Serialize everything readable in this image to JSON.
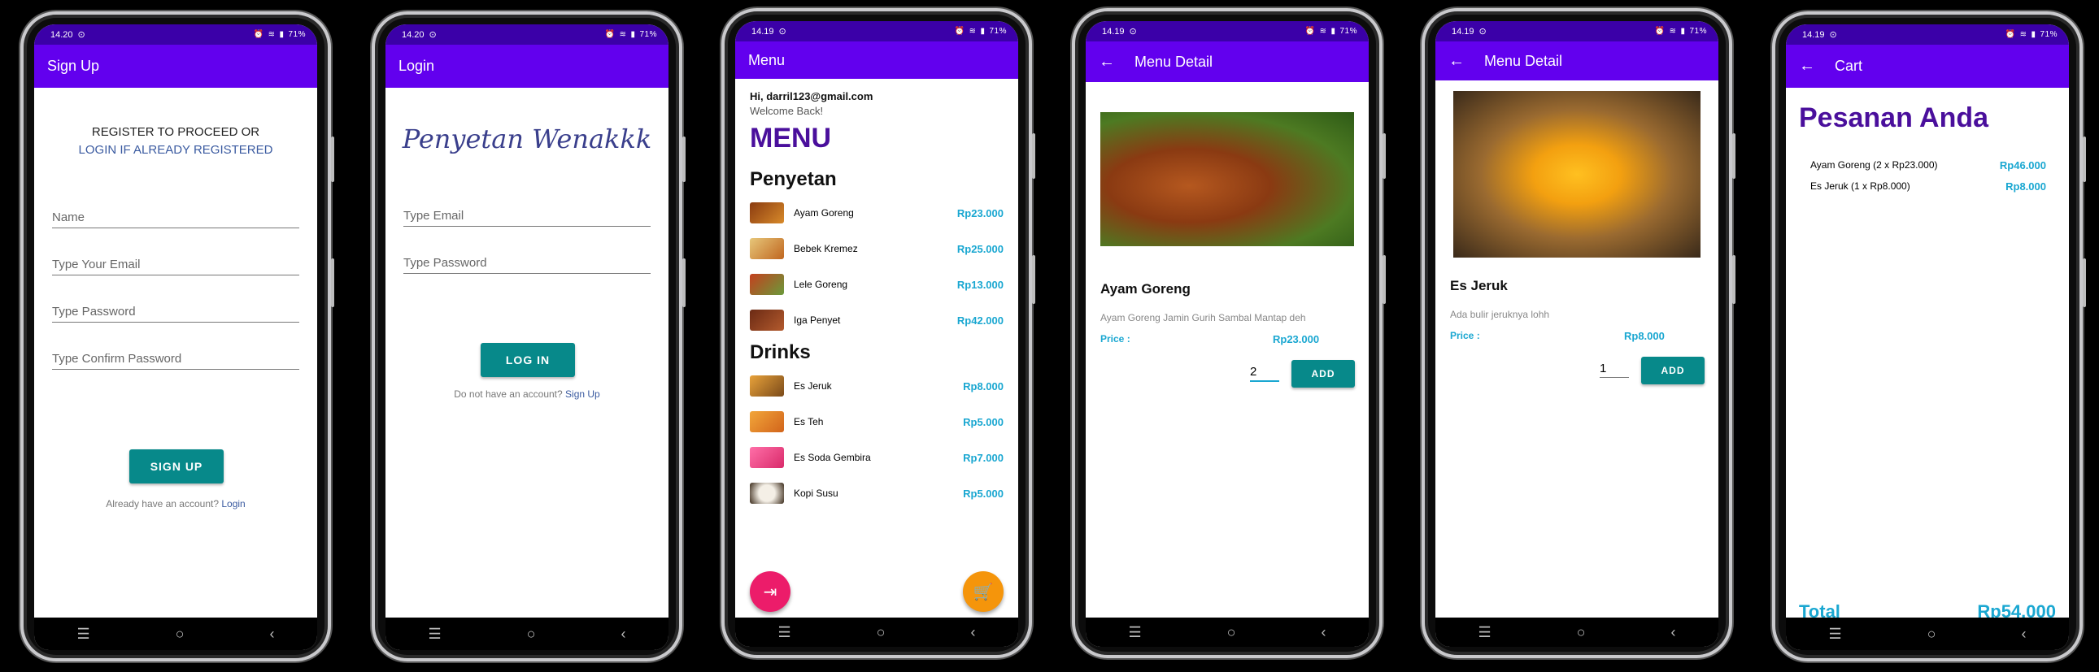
{
  "status": {
    "time_a": "14.20",
    "time_b": "14.19",
    "battery": "71%"
  },
  "nav": {
    "menu_icon": "☰",
    "home_icon": "○",
    "back_icon": "‹"
  },
  "signup": {
    "title": "Sign Up",
    "heading_line1": "REGISTER TO PROCEED OR",
    "heading_line2": "LOGIN IF ALREADY REGISTERED",
    "name_placeholder": "Name",
    "email_placeholder": "Type Your Email",
    "password_placeholder": "Type Password",
    "confirm_placeholder": "Type Confirm Password",
    "button": "SIGN UP",
    "footer_text": "Already have an account?",
    "footer_link": "Login"
  },
  "login": {
    "title": "Login",
    "logo_text": "Penyetan Wenakkk",
    "email_placeholder": "Type Email",
    "password_placeholder": "Type Password",
    "button": "LOG IN",
    "footer_text": "Do not have an account?",
    "footer_link": "Sign Up"
  },
  "menu": {
    "title": "Menu",
    "greeting": "Hi, darril123@gmail.com",
    "welcome": "Welcome Back!",
    "heading": "MENU",
    "section_food": "Penyetan",
    "section_drinks": "Drinks",
    "food": [
      {
        "name": "Ayam Goreng",
        "price": "Rp23.000"
      },
      {
        "name": "Bebek Kremez",
        "price": "Rp25.000"
      },
      {
        "name": "Lele Goreng",
        "price": "Rp13.000"
      },
      {
        "name": "Iga Penyet",
        "price": "Rp42.000"
      }
    ],
    "drinks": [
      {
        "name": "Es Jeruk",
        "price": "Rp8.000"
      },
      {
        "name": "Es Teh",
        "price": "Rp5.000"
      },
      {
        "name": "Es Soda Gembira",
        "price": "Rp7.000"
      },
      {
        "name": "Kopi Susu",
        "price": "Rp5.000"
      }
    ]
  },
  "detail1": {
    "title": "Menu Detail",
    "name": "Ayam Goreng",
    "desc": "Ayam Goreng Jamin Gurih Sambal Mantap deh",
    "price_label": "Price :",
    "price": "Rp23.000",
    "qty": "2",
    "button": "ADD"
  },
  "detail2": {
    "title": "Menu Detail",
    "name": "Es Jeruk",
    "desc": "Ada bulir jeruknya lohh",
    "price_label": "Price :",
    "price": "Rp8.000",
    "qty": "1",
    "button": "ADD"
  },
  "cart": {
    "title": "Cart",
    "heading": "Pesanan Anda",
    "items": [
      {
        "label": "Ayam Goreng (2 x Rp23.000)",
        "price": "Rp46.000"
      },
      {
        "label": "Es Jeruk (1 x Rp8.000)",
        "price": "Rp8.000"
      }
    ],
    "total_label": "Total",
    "total": "Rp54.000"
  },
  "colors": {
    "appbar": "#6200ee",
    "statusbar": "#3b00a8",
    "teal": "#07898a",
    "price": "#1aa7d1",
    "heading": "#4a0f9c"
  }
}
